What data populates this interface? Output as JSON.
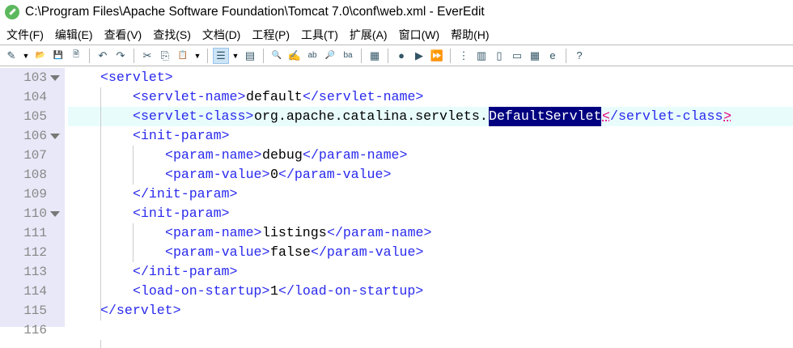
{
  "title": "C:\\Program Files\\Apache Software Foundation\\Tomcat 7.0\\conf\\web.xml - EverEdit",
  "menu": [
    "文件(F)",
    "编辑(E)",
    "查看(V)",
    "查找(S)",
    "文档(D)",
    "工程(P)",
    "工具(T)",
    "扩展(A)",
    "窗口(W)",
    "帮助(H)"
  ],
  "toolbar": [
    "new",
    "dropdown",
    "open",
    "save",
    "save-all",
    "sep",
    "undo",
    "redo",
    "sep",
    "cut",
    "copy",
    "paste",
    "dropdown",
    "sep",
    "wrap",
    "dropdown",
    "outline",
    "sep",
    "find",
    "replace",
    "find-replace",
    "find-in-files",
    "case",
    "sep",
    "column",
    "sep",
    "record",
    "play",
    "play-multi",
    "sep",
    "tree",
    "sidebar",
    "panel",
    "console",
    "table",
    "browser",
    "sep",
    "help"
  ],
  "lines": [
    {
      "n": "103",
      "fold": true,
      "indent": 1,
      "parts": [
        {
          "t": "<servlet>",
          "c": "tag"
        }
      ]
    },
    {
      "n": "104",
      "indent": 2,
      "parts": [
        {
          "t": "<servlet-name>",
          "c": "tag"
        },
        {
          "t": "default",
          "c": "plain"
        },
        {
          "t": "</servlet-name>",
          "c": "tag"
        }
      ]
    },
    {
      "n": "105",
      "indent": 2,
      "current": true,
      "parts": [
        {
          "t": "<servlet-class>",
          "c": "tag"
        },
        {
          "t": "org.apache.catalina.servlets.",
          "c": "plain"
        },
        {
          "t": "DefaultServlet",
          "c": "hl"
        },
        {
          "t": "<",
          "c": "brace"
        },
        {
          "t": "/servlet-class",
          "c": "tag"
        },
        {
          "t": ">",
          "c": "brace"
        }
      ]
    },
    {
      "n": "106",
      "fold": true,
      "indent": 2,
      "parts": [
        {
          "t": "<init-param>",
          "c": "tag"
        }
      ]
    },
    {
      "n": "107",
      "indent": 3,
      "parts": [
        {
          "t": "<param-name>",
          "c": "tag"
        },
        {
          "t": "debug",
          "c": "plain"
        },
        {
          "t": "</param-name>",
          "c": "tag"
        }
      ]
    },
    {
      "n": "108",
      "indent": 3,
      "parts": [
        {
          "t": "<param-value>",
          "c": "tag"
        },
        {
          "t": "0",
          "c": "plain"
        },
        {
          "t": "</param-value>",
          "c": "tag"
        }
      ]
    },
    {
      "n": "109",
      "indent": 2,
      "parts": [
        {
          "t": "</init-param>",
          "c": "tag"
        }
      ]
    },
    {
      "n": "110",
      "fold": true,
      "indent": 2,
      "parts": [
        {
          "t": "<init-param>",
          "c": "tag"
        }
      ]
    },
    {
      "n": "111",
      "indent": 3,
      "parts": [
        {
          "t": "<param-name>",
          "c": "tag"
        },
        {
          "t": "listings",
          "c": "plain"
        },
        {
          "t": "</param-name>",
          "c": "tag"
        }
      ]
    },
    {
      "n": "112",
      "indent": 3,
      "parts": [
        {
          "t": "<param-value>",
          "c": "tag"
        },
        {
          "t": "false",
          "c": "plain"
        },
        {
          "t": "</param-value>",
          "c": "tag"
        }
      ]
    },
    {
      "n": "113",
      "indent": 2,
      "parts": [
        {
          "t": "</init-param>",
          "c": "tag"
        }
      ]
    },
    {
      "n": "114",
      "indent": 2,
      "parts": [
        {
          "t": "<load-on-startup>",
          "c": "tag"
        },
        {
          "t": "1",
          "c": "plain"
        },
        {
          "t": "</load-on-startup>",
          "c": "tag"
        }
      ]
    },
    {
      "n": "115",
      "indent": 1,
      "parts": [
        {
          "t": "</servlet>",
          "c": "tag"
        }
      ]
    },
    {
      "n": "116",
      "indent": 0,
      "parts": []
    }
  ]
}
